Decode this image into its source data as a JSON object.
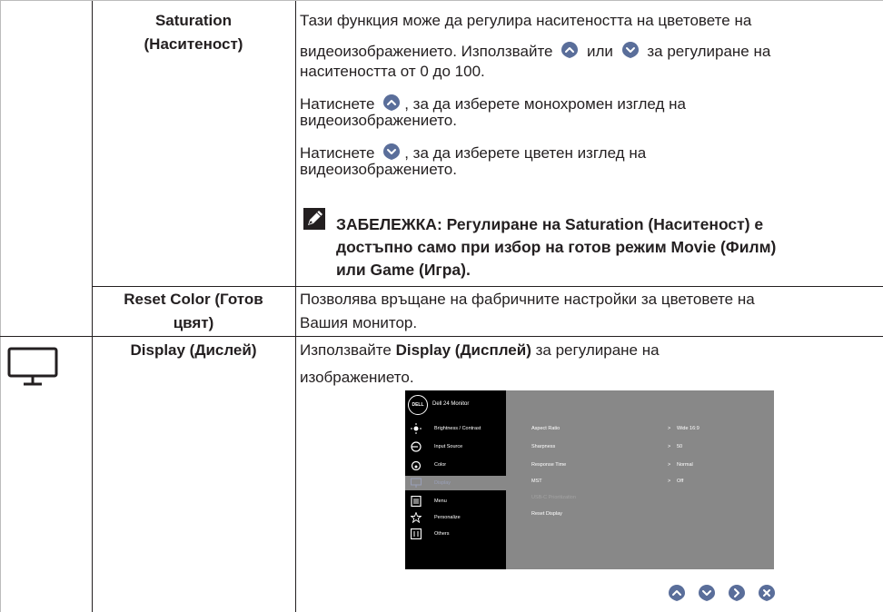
{
  "rows": {
    "saturation": {
      "header_line1": "Saturation",
      "header_line2": "(Наситеност)",
      "p1_a": "Тази функция може да регулира наситеността на цветовете на",
      "p1_b": "видеоизображението. Използвайте",
      "p1_c": "или",
      "p1_d": "за регулиране на",
      "p1_e": "наситеността от 0 до 100.",
      "p2_a": "Натиснете",
      "p2_b": ", за да изберете монохромен изглед на",
      "p2_c": "видеоизображението.",
      "p3_a": "Натиснете",
      "p3_b": ", за да изберете цветен изглед на",
      "p3_c": "видеоизображението.",
      "note_line1": "ЗАБЕЛЕЖКА: Регулиране на Saturation (Наситеност) е",
      "note_line2": "достъпно само при избор на готов режим Movie (Филм)",
      "note_line3": "или Game (Игра)."
    },
    "reset_color": {
      "header_line1": "Reset Color (Готов",
      "header_line2": "цвят)",
      "line1": "Позволява връщане на фабричните настройки за цветовете на",
      "line2": "Вашия монитор."
    },
    "display": {
      "header": "Display (Дислей)",
      "line1_a": "Използвайте",
      "line1_bold": "Display (Дисплей)",
      "line1_c": "за регулиране на",
      "line2": "изображението."
    }
  },
  "osd": {
    "logo": "DELL",
    "model": "Dell 24 Monitor",
    "menu": [
      {
        "label": "Brightness / Contrast",
        "icon": "brightness-icon"
      },
      {
        "label": "Input Source",
        "icon": "input-source-icon"
      },
      {
        "label": "Color",
        "icon": "color-icon"
      },
      {
        "label": "Display",
        "icon": "display-icon",
        "selected": true
      },
      {
        "label": "Menu",
        "icon": "menu-icon"
      },
      {
        "label": "Personalize",
        "icon": "star-icon"
      },
      {
        "label": "Others",
        "icon": "others-icon"
      }
    ],
    "settings": [
      {
        "label": "Aspect Ratio",
        "value": "Wide 16:9"
      },
      {
        "label": "Sharpness",
        "value": "50"
      },
      {
        "label": "Response Time",
        "value": "Normal"
      },
      {
        "label": "MST",
        "value": "Off"
      },
      {
        "label": "USB-C Prioritization",
        "value": "",
        "dim": true
      },
      {
        "label": "Reset Display",
        "value": ""
      }
    ],
    "arrow": ">"
  },
  "nav_buttons": [
    "up-button",
    "down-button",
    "right-button",
    "close-button"
  ],
  "colors": {
    "accent": "#5a6e9a",
    "osd_bg": "#888888",
    "osd_left": "#000000"
  }
}
